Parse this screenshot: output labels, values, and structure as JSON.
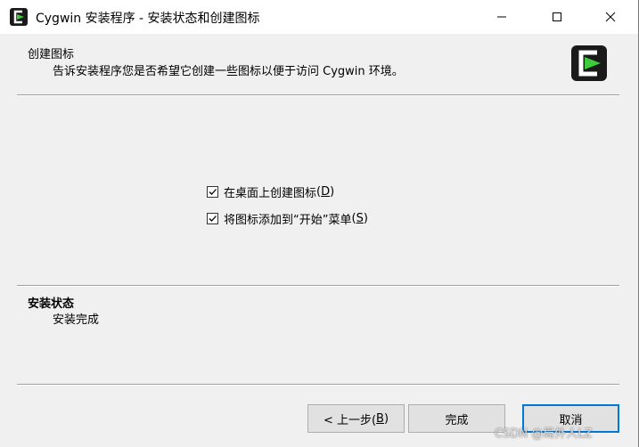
{
  "window": {
    "title": "Cygwin 安装程序 - 安装状态和创建图标"
  },
  "header": {
    "title": "创建图标",
    "description": "告诉安装程序您是否希望它创建一些图标以便于访问 Cygwin 环境。"
  },
  "options": [
    {
      "label": "在桌面上创建图标",
      "accel": "D",
      "checked": true
    },
    {
      "label": "将图标添加到“开始”菜单",
      "accel": "S",
      "checked": true
    }
  ],
  "status": {
    "title": "安装状态",
    "text": "安装完成"
  },
  "buttons": {
    "back": "< 上一步(",
    "back_accel": "B",
    "back_end": ")",
    "finish": "完成",
    "cancel": "取消"
  },
  "watermark": "CSDN @局外人LZ",
  "colors": {
    "accent": "#0078d7",
    "logo_green": "#3ccc3c",
    "logo_dark": "#1a1a1a"
  }
}
